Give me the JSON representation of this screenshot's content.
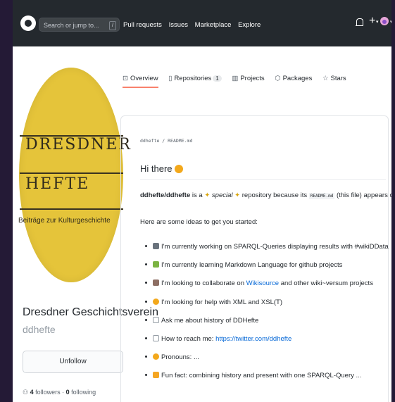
{
  "header": {
    "search_placeholder": "Search or jump to...",
    "search_key": "/",
    "nav": [
      "Pull requests",
      "Issues",
      "Marketplace",
      "Explore"
    ],
    "icons": [
      "github-logo",
      "bell-icon",
      "plus-icon",
      "avatar"
    ]
  },
  "tabs": [
    {
      "label": "Overview",
      "icon": "book-icon",
      "active": true
    },
    {
      "label": "Repositories",
      "icon": "repo-icon",
      "count": "1"
    },
    {
      "label": "Projects",
      "icon": "project-icon"
    },
    {
      "label": "Packages",
      "icon": "package-icon"
    },
    {
      "label": "Stars",
      "icon": "star-icon"
    }
  ],
  "profile": {
    "avatar_lines": [
      "DRESDNER",
      "HEFTE",
      "Beiträge zur Kulturgeschichte"
    ],
    "name": "Dresdner Geschichtsverein",
    "login": "ddhefte",
    "unfollow_label": "Unfollow",
    "followers": "4",
    "followers_label": "followers",
    "following": "0",
    "following_label": "following"
  },
  "readme": {
    "path": "ddhefte / README.md",
    "title": "Hi there",
    "intro": {
      "repo": "ddhefte/ddhefte",
      "text1": " is a ",
      "special": "special",
      "text2": " repository because its ",
      "file": "README.md",
      "text3": " (this file) appears on your GitHub profile."
    },
    "ideas_intro": "Here are some ideas to get you started:",
    "items": [
      {
        "text": "I'm currently working on SPARQL-Queries displaying results with #wikiDData",
        "color": "#6a737d"
      },
      {
        "text": "I'm currently learning Markdown Language for github projects",
        "color": "#7bb342"
      },
      {
        "pre": "I'm looking to collaborate on ",
        "link": "Wikisource",
        "post": " and other wiki~versum projects",
        "color": "#8d6e63"
      },
      {
        "text": "I'm looking for help with XML and XSL(T)",
        "color": "#f3a81b"
      },
      {
        "text": "Ask me about history of DDHefte",
        "color": "#959da5"
      },
      {
        "pre": "How to reach me: ",
        "link": "https://twitter.com/ddhefte",
        "color": "#959da5"
      },
      {
        "text": "Pronouns: ...",
        "color": "#f3a81b"
      },
      {
        "text": "Fun fact: combining history and present with one SPARQL-Query ...",
        "color": "#f5a623"
      }
    ]
  }
}
